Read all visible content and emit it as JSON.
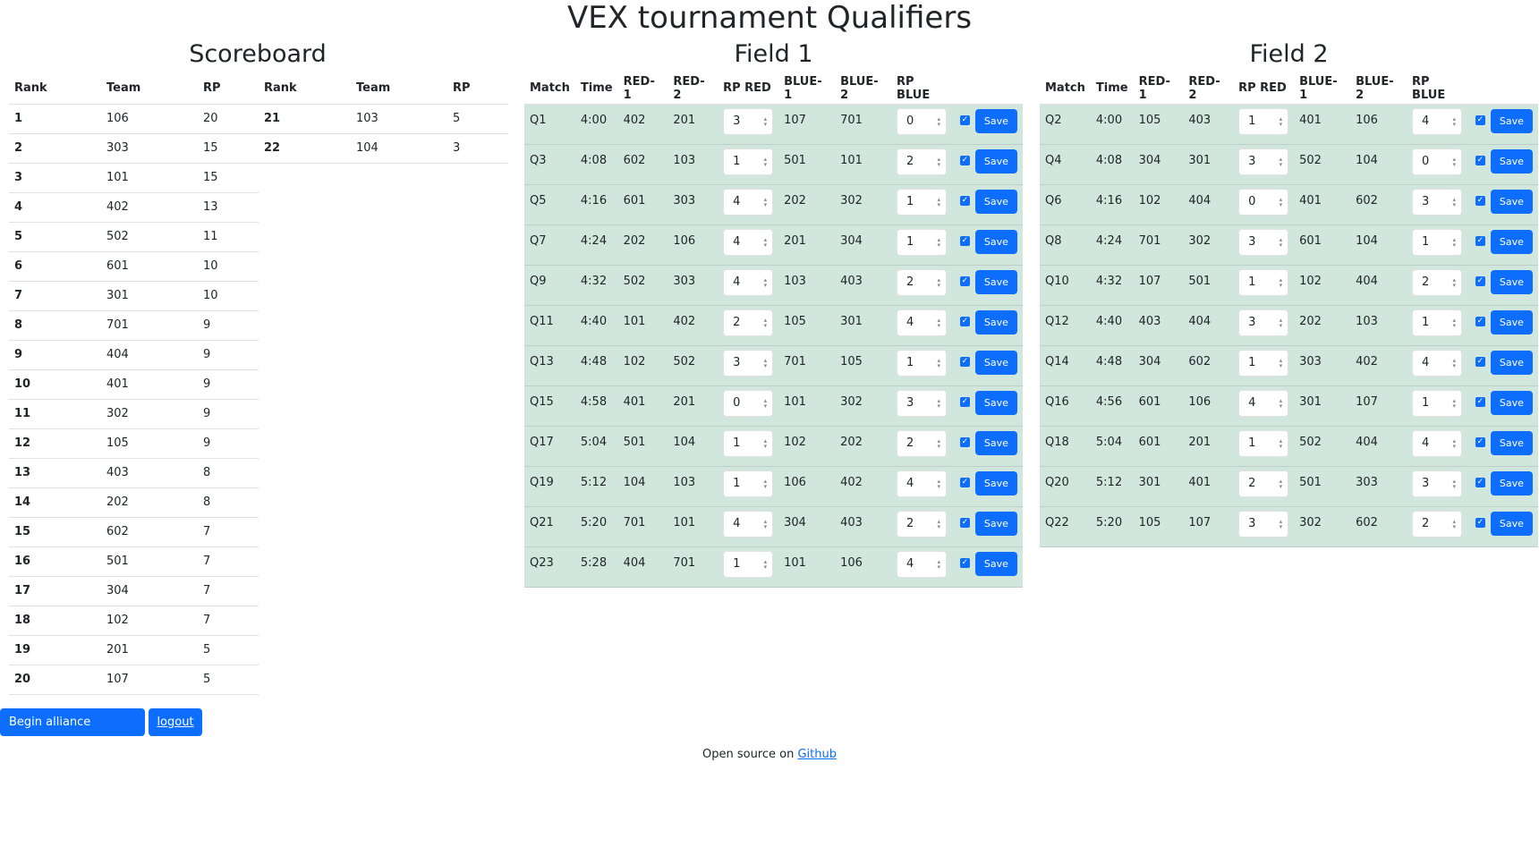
{
  "title": "VEX tournament Qualifiers",
  "scoreboard": {
    "title": "Scoreboard",
    "headers": [
      "Rank",
      "Team",
      "RP"
    ],
    "rows": [
      [
        "1",
        "106",
        "20"
      ],
      [
        "2",
        "303",
        "15"
      ],
      [
        "3",
        "101",
        "15"
      ],
      [
        "4",
        "402",
        "13"
      ],
      [
        "5",
        "502",
        "11"
      ],
      [
        "6",
        "601",
        "10"
      ],
      [
        "7",
        "301",
        "10"
      ],
      [
        "8",
        "701",
        "9"
      ],
      [
        "9",
        "404",
        "9"
      ],
      [
        "10",
        "401",
        "9"
      ],
      [
        "11",
        "302",
        "9"
      ],
      [
        "12",
        "105",
        "9"
      ],
      [
        "13",
        "403",
        "8"
      ],
      [
        "14",
        "202",
        "8"
      ],
      [
        "15",
        "602",
        "7"
      ],
      [
        "16",
        "501",
        "7"
      ],
      [
        "17",
        "304",
        "7"
      ],
      [
        "18",
        "102",
        "7"
      ],
      [
        "19",
        "201",
        "5"
      ],
      [
        "20",
        "107",
        "5"
      ]
    ],
    "rows2": [
      [
        "21",
        "103",
        "5"
      ],
      [
        "22",
        "104",
        "3"
      ]
    ]
  },
  "match_headers": [
    "Match",
    "Time",
    "RED-1",
    "RED-2",
    "RP RED",
    "BLUE-1",
    "BLUE-2",
    "RP BLUE"
  ],
  "save_label": "Save",
  "fields": [
    {
      "title": "Field 1",
      "matches": [
        {
          "match": "Q1",
          "time": "4:00",
          "red1": "402",
          "red2": "201",
          "rp_red": "3",
          "blue1": "107",
          "blue2": "701",
          "rp_blue": "0",
          "checked": true
        },
        {
          "match": "Q3",
          "time": "4:08",
          "red1": "602",
          "red2": "103",
          "rp_red": "1",
          "blue1": "501",
          "blue2": "101",
          "rp_blue": "2",
          "checked": true
        },
        {
          "match": "Q5",
          "time": "4:16",
          "red1": "601",
          "red2": "303",
          "rp_red": "4",
          "blue1": "202",
          "blue2": "302",
          "rp_blue": "1",
          "checked": true
        },
        {
          "match": "Q7",
          "time": "4:24",
          "red1": "202",
          "red2": "106",
          "rp_red": "4",
          "blue1": "201",
          "blue2": "304",
          "rp_blue": "1",
          "checked": true
        },
        {
          "match": "Q9",
          "time": "4:32",
          "red1": "502",
          "red2": "303",
          "rp_red": "4",
          "blue1": "103",
          "blue2": "403",
          "rp_blue": "2",
          "checked": true
        },
        {
          "match": "Q11",
          "time": "4:40",
          "red1": "101",
          "red2": "402",
          "rp_red": "2",
          "blue1": "105",
          "blue2": "301",
          "rp_blue": "4",
          "checked": true
        },
        {
          "match": "Q13",
          "time": "4:48",
          "red1": "102",
          "red2": "502",
          "rp_red": "3",
          "blue1": "701",
          "blue2": "105",
          "rp_blue": "1",
          "checked": true
        },
        {
          "match": "Q15",
          "time": "4:58",
          "red1": "401",
          "red2": "201",
          "rp_red": "0",
          "blue1": "101",
          "blue2": "302",
          "rp_blue": "3",
          "checked": true
        },
        {
          "match": "Q17",
          "time": "5:04",
          "red1": "501",
          "red2": "104",
          "rp_red": "1",
          "blue1": "102",
          "blue2": "202",
          "rp_blue": "2",
          "checked": true
        },
        {
          "match": "Q19",
          "time": "5:12",
          "red1": "104",
          "red2": "103",
          "rp_red": "1",
          "blue1": "106",
          "blue2": "402",
          "rp_blue": "4",
          "checked": true
        },
        {
          "match": "Q21",
          "time": "5:20",
          "red1": "701",
          "red2": "101",
          "rp_red": "4",
          "blue1": "304",
          "blue2": "403",
          "rp_blue": "2",
          "checked": true
        },
        {
          "match": "Q23",
          "time": "5:28",
          "red1": "404",
          "red2": "701",
          "rp_red": "1",
          "blue1": "101",
          "blue2": "106",
          "rp_blue": "4",
          "checked": true
        }
      ]
    },
    {
      "title": "Field 2",
      "matches": [
        {
          "match": "Q2",
          "time": "4:00",
          "red1": "105",
          "red2": "403",
          "rp_red": "1",
          "blue1": "401",
          "blue2": "106",
          "rp_blue": "4",
          "checked": true
        },
        {
          "match": "Q4",
          "time": "4:08",
          "red1": "304",
          "red2": "301",
          "rp_red": "3",
          "blue1": "502",
          "blue2": "104",
          "rp_blue": "0",
          "checked": true
        },
        {
          "match": "Q6",
          "time": "4:16",
          "red1": "102",
          "red2": "404",
          "rp_red": "0",
          "blue1": "401",
          "blue2": "602",
          "rp_blue": "3",
          "checked": true
        },
        {
          "match": "Q8",
          "time": "4:24",
          "red1": "701",
          "red2": "302",
          "rp_red": "3",
          "blue1": "601",
          "blue2": "104",
          "rp_blue": "1",
          "checked": true
        },
        {
          "match": "Q10",
          "time": "4:32",
          "red1": "107",
          "red2": "501",
          "rp_red": "1",
          "blue1": "102",
          "blue2": "404",
          "rp_blue": "2",
          "checked": true
        },
        {
          "match": "Q12",
          "time": "4:40",
          "red1": "403",
          "red2": "404",
          "rp_red": "3",
          "blue1": "202",
          "blue2": "103",
          "rp_blue": "1",
          "checked": true
        },
        {
          "match": "Q14",
          "time": "4:48",
          "red1": "304",
          "red2": "602",
          "rp_red": "1",
          "blue1": "303",
          "blue2": "402",
          "rp_blue": "4",
          "checked": true
        },
        {
          "match": "Q16",
          "time": "4:56",
          "red1": "601",
          "red2": "106",
          "rp_red": "4",
          "blue1": "301",
          "blue2": "107",
          "rp_blue": "1",
          "checked": true
        },
        {
          "match": "Q18",
          "time": "5:04",
          "red1": "601",
          "red2": "201",
          "rp_red": "1",
          "blue1": "502",
          "blue2": "404",
          "rp_blue": "4",
          "checked": true
        },
        {
          "match": "Q20",
          "time": "5:12",
          "red1": "301",
          "red2": "401",
          "rp_red": "2",
          "blue1": "501",
          "blue2": "303",
          "rp_blue": "3",
          "checked": true
        },
        {
          "match": "Q22",
          "time": "5:20",
          "red1": "105",
          "red2": "107",
          "rp_red": "3",
          "blue1": "302",
          "blue2": "602",
          "rp_blue": "2",
          "checked": true
        }
      ]
    }
  ],
  "actions": {
    "begin_label": "Begin alliance selection",
    "logout_label": "logout"
  },
  "footer": {
    "text": "Open source on",
    "link": "Github"
  },
  "colors": {
    "primary": "#0d6efd",
    "row_success": "#d1e7dd"
  }
}
